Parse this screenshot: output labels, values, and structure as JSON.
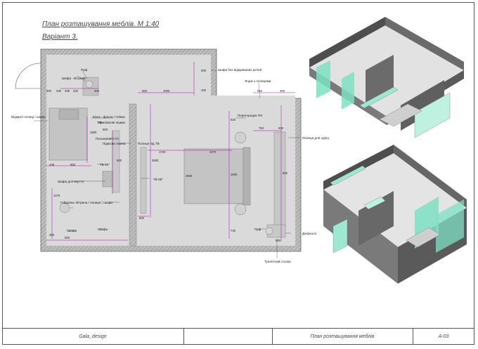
{
  "sheet": {
    "title": "План розташування меблів. М 1:40",
    "subtitle": "Варіант 3."
  },
  "labels": {
    "wardrobe_hinged": "Шафа - Вітрина",
    "pouf": "Пуф",
    "wardrobe_open_shelves": "Шафа без відкриваних речей",
    "bookshelf": "Ящик з полицями",
    "open_shelves": "Відкриті полиці / шафа",
    "kiosk": "Кіоск - фасад / плівка",
    "bedside": "Приліжкові ящики",
    "shelf_tv": "Полиця під ТВ",
    "desk": "Письмовий стіл",
    "desk_lamp": "Підвісна лампа",
    "partition": "Перегородка ПЛ",
    "clothes_shelf": "Полиця для одягу",
    "shoe_rack": "Шафа для взуття",
    "swing_chair": "Гойдалка",
    "shelf_left": "Шафа",
    "shelf_right": "Шафа",
    "tv1": "ТВ 43\"",
    "tv2": "ТВ 65\"",
    "dresser": "Вітрина / полиця / шафа",
    "pouf2": "Пуф",
    "mirror": "Дзеркало",
    "toilet_table": "Туалетний столик"
  },
  "dims": {
    "d1": "300",
    "d2": "335",
    "d3": "335",
    "d4": "320",
    "d5": "300",
    "d6": "500",
    "d7": "500",
    "d8": "500",
    "d9": "400",
    "d10": "915",
    "d11": "400",
    "d12": "500",
    "d13": "500",
    "d14": "1000",
    "d15": "750",
    "d16": "500",
    "d17": "2270",
    "d18": "1720",
    "d19": "3500",
    "d20": "1800",
    "d21": "1800",
    "d22": "760",
    "d23": "2800",
    "d24": "500",
    "d25": "600",
    "d26": "438",
    "d27": "1275",
    "d28": "500",
    "d29": "300",
    "d30": "745",
    "d31": "855",
    "d32": "625"
  },
  "title_block": {
    "author": "Gala_design",
    "sheet_name": "План розташування меблів",
    "sheet_code": "А-03"
  },
  "colors": {
    "wall_fill": "#c9c9c9",
    "floor_fill": "#d9d9d9",
    "dimension_line": "#b000b0",
    "iso_wall": "#5a5a5a",
    "iso_accent": "#7fe0c4"
  }
}
